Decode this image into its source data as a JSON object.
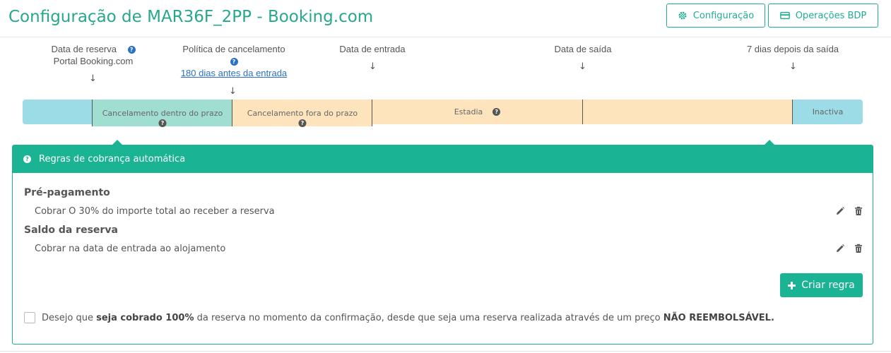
{
  "header": {
    "title": "Configuração de MAR36F_2PP - Booking.com",
    "config_button": "Configuração",
    "ops_button": "Operações BDP"
  },
  "timeline": {
    "reservation_date": "Data de reserva",
    "reservation_portal": "Portal Booking.com",
    "cancellation_policy": "Política de cancelamento",
    "cancellation_link": "180 dias antes da entrada",
    "checkin": "Data de entrada",
    "checkout": "Data de saída",
    "after_checkout": "7 dias depois da saída",
    "arrow": "↓",
    "segments": {
      "cancel_in_time": "Cancelamento dentro do prazo",
      "cancel_late": "Cancelamento fora do prazo",
      "stay": "Estadia",
      "inactive": "Inactiva"
    },
    "colors": {
      "outside": "#9bdce6",
      "cancel_in_time": "#a0ded1",
      "stay": "#fde4bc"
    }
  },
  "panel": {
    "title": "Regras de cobrança automática",
    "sections": [
      {
        "heading": "Pré-pagamento",
        "rule": "Cobrar O 30% do importe total ao receber a reserva"
      },
      {
        "heading": "Saldo da reserva",
        "rule": "Cobrar na data de entrada ao alojamento"
      }
    ],
    "create_button": "Criar regra",
    "consent": {
      "prefix": "Desejo que",
      "bold1": "seja cobrado 100%",
      "middle": "da reserva no momento da confirmação, desde que seja uma reserva realizada através de um preço",
      "bold2": "NÃO REEMBOLSÁVEL.",
      "checked": false
    }
  },
  "icons": {
    "help": "question-circle-icon",
    "edit": "pencil-icon",
    "delete": "trash-icon",
    "config": "gear-icon",
    "ops": "credit-card-icon",
    "create": "plus-icon"
  },
  "colors": {
    "accent": "#1ab394",
    "link": "#2b71c4"
  }
}
